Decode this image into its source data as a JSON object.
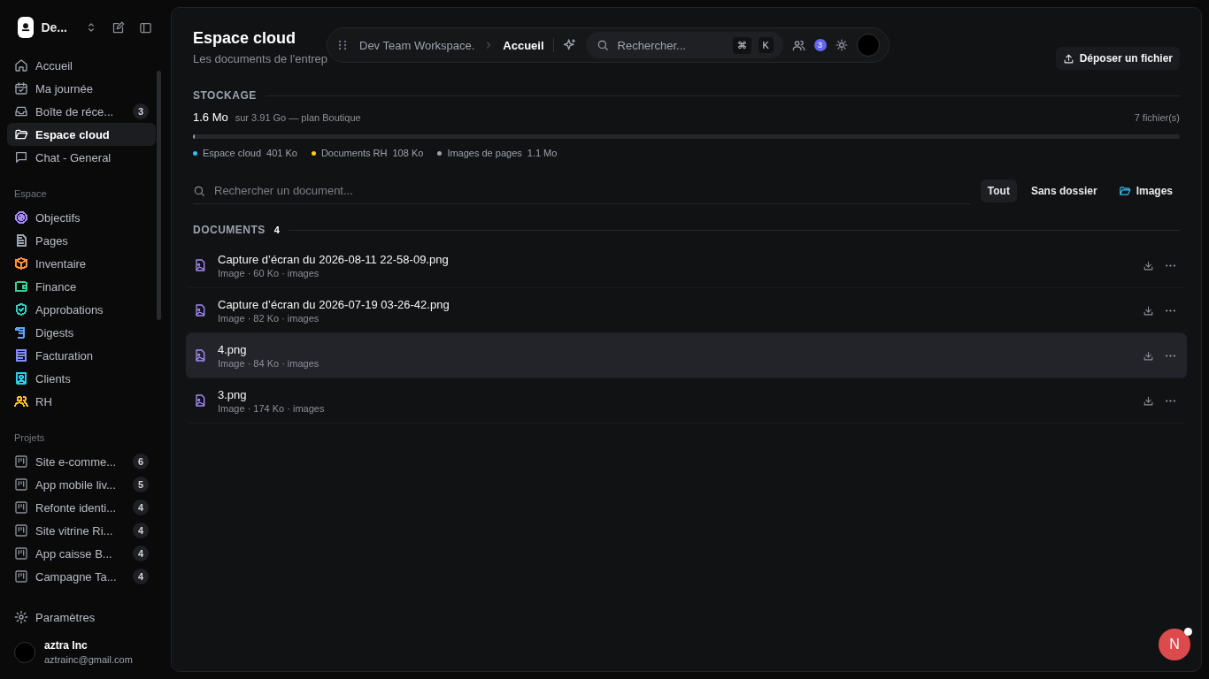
{
  "workspace": {
    "name": "De..."
  },
  "nav": [
    {
      "label": "Accueil",
      "selected": false
    },
    {
      "label": "Ma journée",
      "selected": false
    },
    {
      "label": "Boîte de réce...",
      "badge": "3",
      "selected": false
    },
    {
      "label": "Espace cloud",
      "selected": true
    },
    {
      "label": "Chat - General",
      "selected": false
    }
  ],
  "space_section": {
    "title": "Espace",
    "items": [
      {
        "label": "Objectifs",
        "color": "#a78bfa"
      },
      {
        "label": "Pages",
        "color": "#9ca3af"
      },
      {
        "label": "Inventaire",
        "color": "#fb923c"
      },
      {
        "label": "Finance",
        "color": "#34d399"
      },
      {
        "label": "Approbations",
        "color": "#2dd4bf"
      },
      {
        "label": "Digests",
        "color": "#60a5fa"
      },
      {
        "label": "Facturation",
        "color": "#818cf8"
      },
      {
        "label": "Clients",
        "color": "#22d3ee"
      },
      {
        "label": "RH",
        "color": "#fbbf24"
      }
    ]
  },
  "projects": {
    "title": "Projets",
    "items": [
      {
        "label": "Site e-comme...",
        "count": "6"
      },
      {
        "label": "App mobile liv...",
        "count": "5"
      },
      {
        "label": "Refonte identi...",
        "count": "4"
      },
      {
        "label": "Site vitrine Ri...",
        "count": "4"
      },
      {
        "label": "App caisse B...",
        "count": "4"
      },
      {
        "label": "Campagne Ta...",
        "count": "4"
      }
    ]
  },
  "settings": {
    "label": "Paramètres"
  },
  "user": {
    "name": "aztra Inc",
    "email": "aztrainc@gmail.com"
  },
  "topbar": {
    "breadcrumb": [
      "Dev Team Workspace.",
      "Accueil"
    ],
    "search_placeholder": "Rechercher...",
    "keys": [
      "⌘",
      "K"
    ],
    "notifications": "3"
  },
  "page": {
    "title": "Espace cloud",
    "subtitle": "Les documents de l'entrep",
    "upload_button": "Déposer un fichier"
  },
  "storage": {
    "heading": "STOCKAGE",
    "used": "1.6 Mo",
    "quota": "sur 3.91 Go — plan Boutique",
    "files": "7 fichier(s)",
    "level": 0.002,
    "legend": [
      {
        "label": "Espace cloud",
        "size": "401 Ko",
        "color": "#38bdf8"
      },
      {
        "label": "Documents RH",
        "size": "108 Ko",
        "color": "#facc15"
      },
      {
        "label": "Images de pages",
        "size": "1.1 Mo",
        "color": "#9ca3af"
      }
    ]
  },
  "doc_search": {
    "placeholder": "Rechercher un document..."
  },
  "filters": [
    {
      "label": "Tout",
      "selected": true,
      "kind": "plain"
    },
    {
      "label": "Sans dossier",
      "selected": false,
      "kind": "plain"
    },
    {
      "label": "Images",
      "selected": false,
      "kind": "folder"
    }
  ],
  "documents": {
    "heading": "DOCUMENTS",
    "count": "4",
    "items": [
      {
        "name": "Capture d’écran du 2026-08-11 22-58-09.png",
        "meta": "Image · 60 Ko · images",
        "selected": false
      },
      {
        "name": "Capture d’écran du 2026-07-19 03-26-42.png",
        "meta": "Image · 82 Ko · images",
        "selected": false
      },
      {
        "name": "4.png",
        "meta": "Image · 84 Ko · images",
        "selected": true
      },
      {
        "name": "3.png",
        "meta": "Image · 174 Ko · images",
        "selected": false
      }
    ]
  },
  "fab": {
    "label": "N"
  }
}
